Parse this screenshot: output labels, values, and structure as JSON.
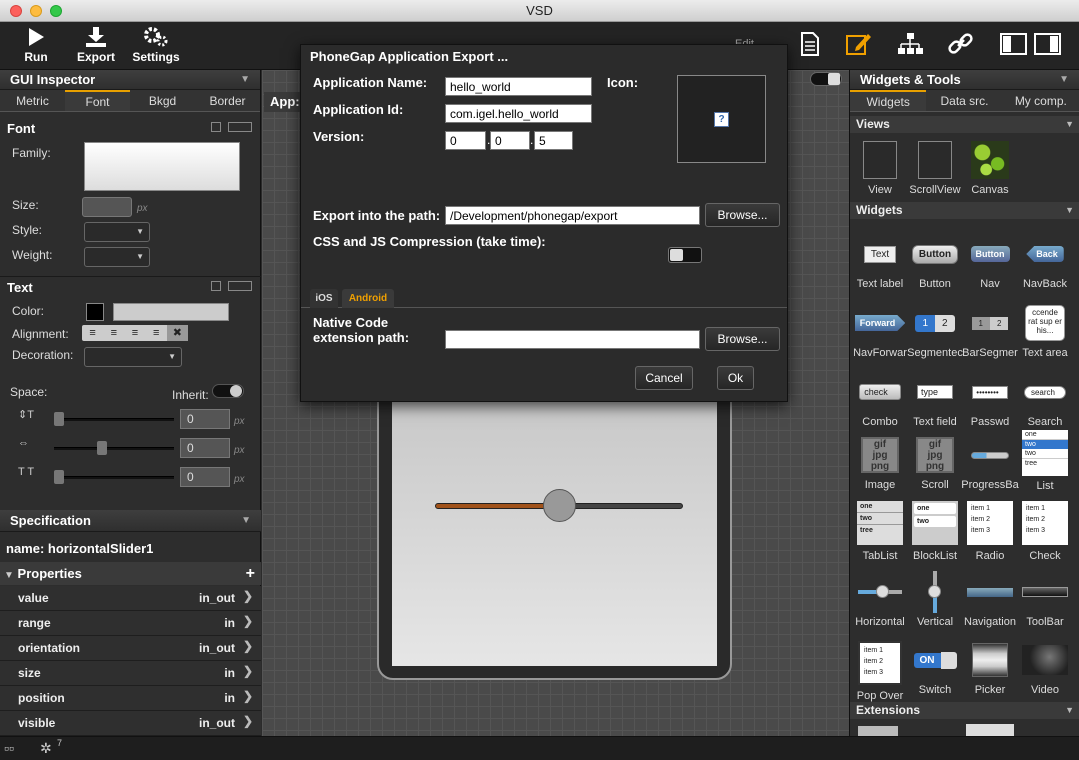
{
  "window": {
    "title": "VSD"
  },
  "toolbar": {
    "run": "Run",
    "export": "Export",
    "settings": "Settings",
    "edit_label": "Edit"
  },
  "inspector": {
    "title": "GUI Inspector",
    "tabs": [
      "Metric",
      "Font",
      "Bkgd",
      "Border"
    ],
    "active_tab": "Font",
    "font_section": "Font",
    "family_label": "Family:",
    "size_label": "Size:",
    "size_unit": "px",
    "style_label": "Style:",
    "weight_label": "Weight:",
    "text_section": "Text",
    "color_label": "Color:",
    "alignment_label": "Alignment:",
    "decoration_label": "Decoration:",
    "space_label": "Space:",
    "inherit_label": "Inherit:",
    "spacing_values": [
      "0",
      "0",
      "0"
    ],
    "spacing_unit": "px"
  },
  "specification": {
    "title": "Specification",
    "name_label": "name:",
    "name_value": "horizontalSlider1",
    "properties_label": "Properties",
    "properties": [
      {
        "name": "value",
        "value": "in_out"
      },
      {
        "name": "range",
        "value": "in"
      },
      {
        "name": "orientation",
        "value": "in_out"
      },
      {
        "name": "size",
        "value": "in"
      },
      {
        "name": "position",
        "value": "in"
      },
      {
        "name": "visible",
        "value": "in_out"
      }
    ]
  },
  "canvas": {
    "app_tab": "App:"
  },
  "dialog": {
    "title": "PhoneGap Application Export ...",
    "app_name_label": "Application Name:",
    "app_name_value": "hello_world",
    "app_id_label": "Application Id:",
    "app_id_value": "com.igel.hello_world",
    "version_label": "Version:",
    "version_parts": [
      "0",
      "0",
      "5"
    ],
    "icon_label": "Icon:",
    "icon_placeholder": "?",
    "export_path_label": "Export into the path:",
    "export_path_value": "/Development/phonegap/export",
    "browse": "Browse...",
    "compression_label": "CSS and JS Compression (take time):",
    "tabs": [
      "iOS",
      "Android"
    ],
    "active_tab": "Android",
    "native_label_1": "Native Code",
    "native_label_2": "extension path:",
    "native_value": "",
    "cancel": "Cancel",
    "ok": "Ok"
  },
  "widgets": {
    "title": "Widgets & Tools",
    "tabs": [
      "Widgets",
      "Data src.",
      "My comp."
    ],
    "active_tab": "Widgets",
    "sections": [
      "Views",
      "Widgets",
      "Extensions"
    ],
    "views": [
      "View",
      "ScrollView",
      "Canvas"
    ],
    "items": [
      "Text label",
      "Button",
      "Nav",
      "NavBack",
      "NavForwar",
      "Segmentec",
      "BarSegmer",
      "Text area",
      "Combo",
      "Text field",
      "Passwd",
      "Search",
      "Image",
      "Scroll",
      "ProgressBa",
      "List",
      "TabList",
      "BlockList",
      "Radio",
      "Check",
      "Horizontal",
      "Vertical",
      "Navigation",
      "ToolBar",
      "Pop Over",
      "Switch",
      "Picker",
      "Video"
    ],
    "icon_texts": {
      "text": "Text",
      "button": "Button",
      "nav": "Button",
      "navback": "Back",
      "forward": "Forward",
      "seg1": "1",
      "seg2": "2",
      "bar1": "1",
      "bar2": "2",
      "textarea": "ccende rat sup er his...",
      "combo": "check",
      "textfield": "type",
      "passwd": "••••••••",
      "search": "search",
      "switch": "ON",
      "jpg": "jpg",
      "gif": "gif",
      "png": "png",
      "list_rows": [
        "one",
        "two",
        "two",
        "tree"
      ],
      "radio_rows": [
        "item 1",
        "item 2",
        "item 3"
      ]
    }
  },
  "status": {
    "badge": "7"
  }
}
